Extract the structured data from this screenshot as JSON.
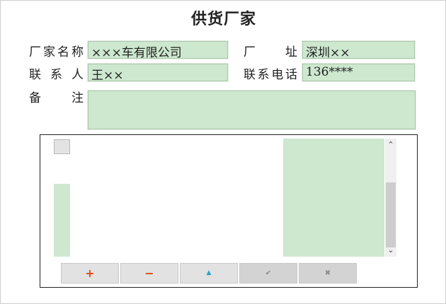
{
  "form": {
    "title": "供货厂家",
    "fields": {
      "manufacturer_name": {
        "label_chars": [
          "厂",
          "家",
          "名",
          "称"
        ],
        "value": "×××车有限公司"
      },
      "address": {
        "label_chars": [
          "厂",
          "址"
        ],
        "value": "深圳××"
      },
      "contact": {
        "label_chars": [
          "联",
          "系",
          "人"
        ],
        "value": "王××"
      },
      "phone": {
        "label_chars": [
          "联",
          "系",
          "电",
          "话"
        ],
        "value": "136****"
      },
      "remarks": {
        "label_chars": [
          "备",
          "注"
        ],
        "value": ""
      }
    }
  },
  "toolbar": {
    "buttons": [
      {
        "name": "add",
        "icon": "+",
        "icon_name": "plus-icon",
        "color": "#e04a1a",
        "enabled": true
      },
      {
        "name": "delete",
        "icon": "−",
        "icon_name": "minus-icon",
        "color": "#e04a1a",
        "enabled": true
      },
      {
        "name": "edit",
        "icon": "▲",
        "icon_name": "triangle-up-icon",
        "color": "#2aa0c8",
        "enabled": true
      },
      {
        "name": "confirm",
        "icon": "✔",
        "icon_name": "check-icon",
        "color": "#8a8a8a",
        "enabled": false
      },
      {
        "name": "cancel",
        "icon": "✖",
        "icon_name": "x-icon",
        "color": "#8a8a8a",
        "enabled": false
      }
    ]
  },
  "scrollbar": {
    "up": "⌃",
    "down": "⌄"
  },
  "colors": {
    "field_bg": "#cde8cf",
    "border": "#a9c7ab"
  }
}
